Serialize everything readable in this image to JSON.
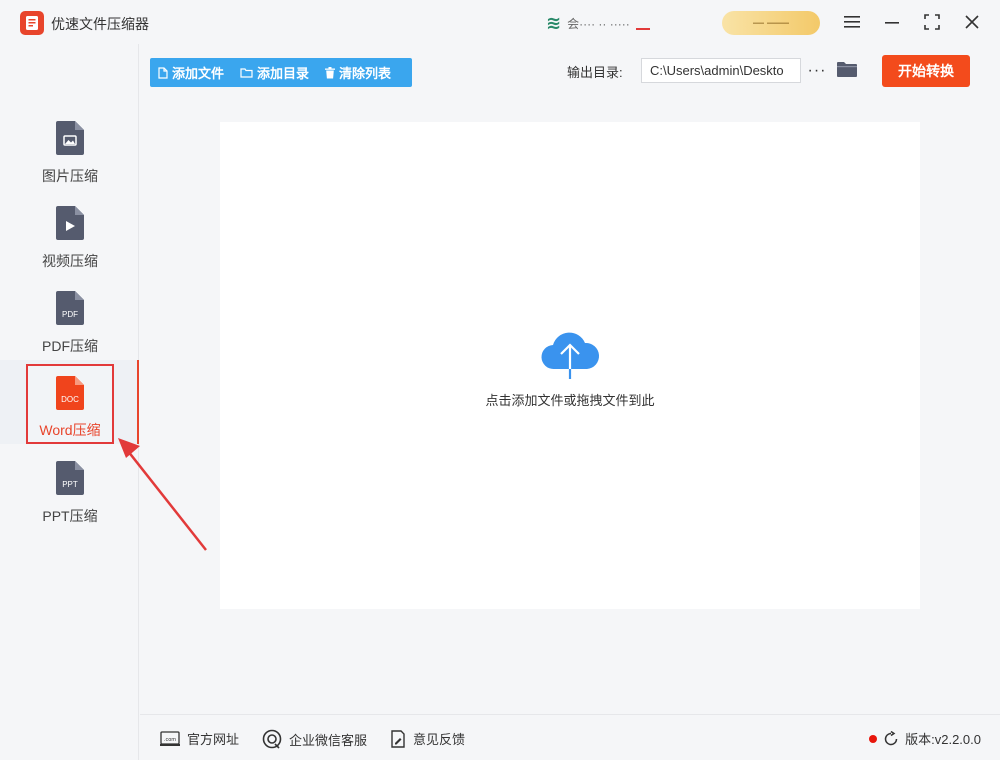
{
  "app": {
    "title": "优速文件压缩器"
  },
  "user": {
    "avatar_text": "≋",
    "name": "会···· ·· ·····",
    "badge": "— ——"
  },
  "sidebar": {
    "items": [
      {
        "label": "图片压缩",
        "icon": "image-file-icon",
        "tag": ""
      },
      {
        "label": "视频压缩",
        "icon": "video-file-icon",
        "tag": ""
      },
      {
        "label": "PDF压缩",
        "icon": "pdf-file-icon",
        "tag": "PDF"
      },
      {
        "label": "Word压缩",
        "icon": "doc-file-icon",
        "tag": "DOC",
        "active": true
      },
      {
        "label": "PPT压缩",
        "icon": "ppt-file-icon",
        "tag": "PPT"
      }
    ]
  },
  "toolbar": {
    "add_file": "添加文件",
    "add_folder": "添加目录",
    "clear_list": "清除列表",
    "output_label": "输出目录:",
    "output_path": "C:\\Users\\admin\\Deskto",
    "more": "···",
    "start": "开始转换"
  },
  "dropzone": {
    "hint": "点击添加文件或拖拽文件到此"
  },
  "footer": {
    "website": "官方网址",
    "wechat": "企业微信客服",
    "feedback": "意见反馈",
    "version_label": "版本:v2.2.0.0"
  },
  "colors": {
    "accent": "#3aa6ee",
    "primary_action": "#f34b1c",
    "active": "#e8452c",
    "icon_dark": "#555b6e"
  }
}
